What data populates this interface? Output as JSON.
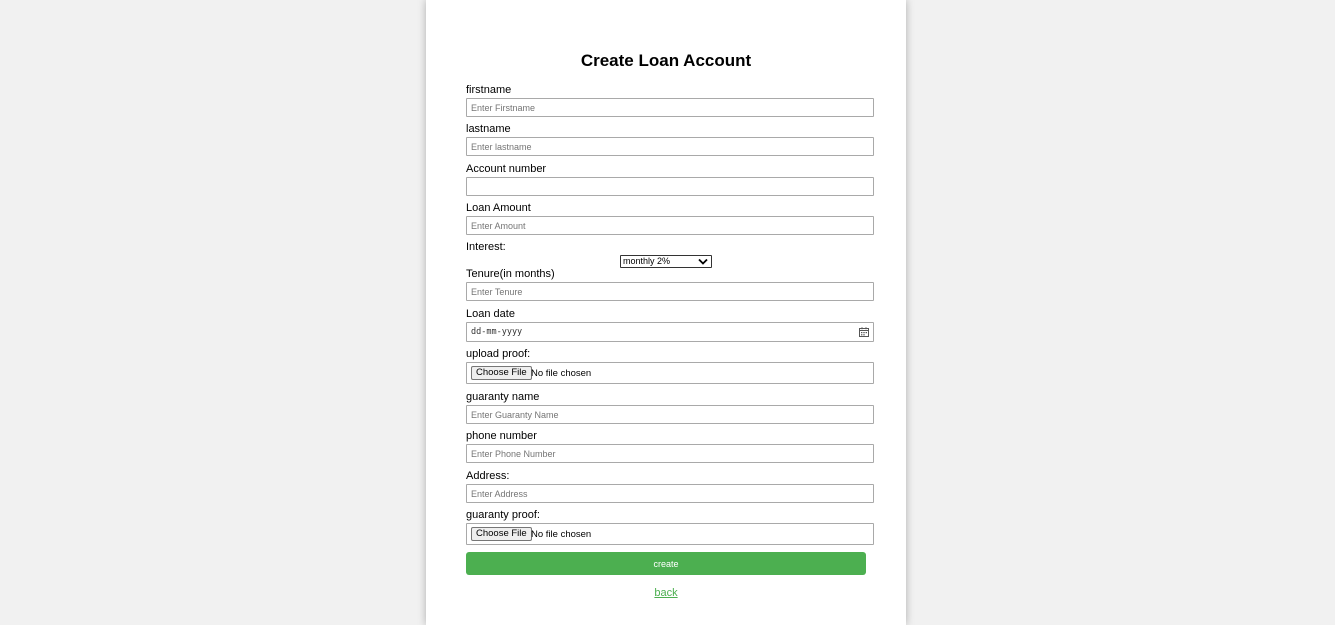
{
  "form": {
    "title": "Create Loan Account",
    "firstname": {
      "label": "firstname",
      "placeholder": "Enter Firstname"
    },
    "lastname": {
      "label": "lastname",
      "placeholder": "Enter lastname"
    },
    "account_number": {
      "label": "Account number",
      "placeholder": ""
    },
    "loan_amount": {
      "label": "Loan Amount",
      "placeholder": "Enter Amount"
    },
    "interest": {
      "label": "Interest:",
      "selected": "monthly 2%"
    },
    "tenure": {
      "label": "Tenure(in months)",
      "placeholder": "Enter Tenure"
    },
    "loan_date": {
      "label": "Loan date",
      "placeholder": "dd-mm-yyyy"
    },
    "upload_proof": {
      "label": "upload proof:",
      "button": "Choose File",
      "status": "No file chosen"
    },
    "guaranty_name": {
      "label": "guaranty name",
      "placeholder": "Enter Guaranty Name"
    },
    "phone_number": {
      "label": "phone number",
      "placeholder": "Enter Phone Number"
    },
    "address": {
      "label": "Address:",
      "placeholder": "Enter Address"
    },
    "guaranty_proof": {
      "label": "guaranty proof:",
      "button": "Choose File",
      "status": "No file chosen"
    },
    "submit_label": "create",
    "back_label": "back"
  },
  "colors": {
    "accent": "#4caf50",
    "page_background": "#f1f1f1",
    "card_background": "#ffffff"
  },
  "icons": {
    "interest_caret": "chevron-down-icon",
    "date_picker": "calendar-icon"
  }
}
